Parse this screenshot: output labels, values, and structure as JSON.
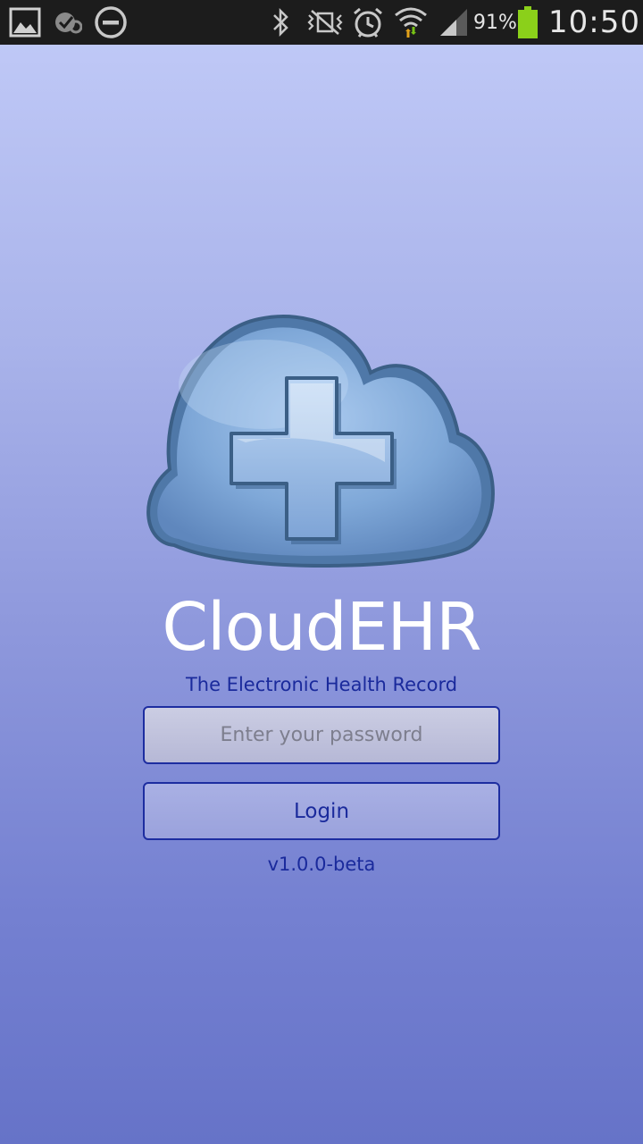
{
  "status_bar": {
    "battery_percent": "91%",
    "time": "10:50",
    "icons": [
      "gallery-icon",
      "sync-check-icon",
      "do-not-disturb-icon",
      "bluetooth-icon",
      "vibrate-mute-icon",
      "alarm-icon",
      "wifi-icon",
      "signal-icon",
      "battery-icon"
    ],
    "battery_color": "#8bd01a"
  },
  "app": {
    "title": "CloudEHR",
    "subtitle": "The Electronic Health Record",
    "version": "v1.0.0-beta"
  },
  "login_form": {
    "password_placeholder": "Enter your password",
    "password_value": "",
    "login_label": "Login"
  },
  "colors": {
    "accent_text": "#1a2a9c",
    "background_top": "#c2cbf8",
    "background_bottom": "#6673c8"
  }
}
